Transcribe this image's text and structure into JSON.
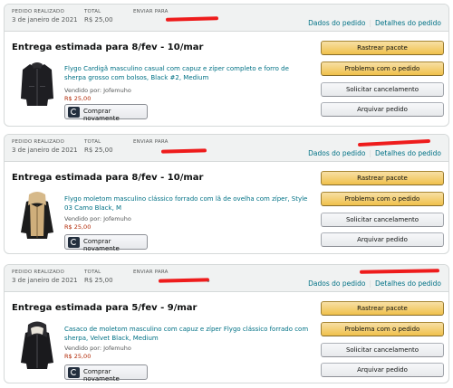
{
  "labels": {
    "order_placed": "PEDIDO REALIZADO",
    "total": "TOTAL",
    "ship_to": "ENVIAR PARA",
    "order_details": "Dados do pedido",
    "invoice_details": "Detalhes do pedido",
    "sold_by": "Vendido por: Jofemuho",
    "buy_again": "Comprar novamente",
    "track": "Rastrear pacote",
    "problem": "Problema com o pedido",
    "cancel": "Solicitar cancelamento",
    "archive": "Arquivar pedido"
  },
  "orders": [
    {
      "date": "3 de janeiro de 2021",
      "total": "R$ 25,00",
      "delivery": "Entrega estimada para 8/fev - 10/mar",
      "product_title": "Flygo Cardigã masculino casual com capuz e zíper completo e forro de sherpa grosso com bolsos, Black #2, Medium",
      "price": "R$ 25,00"
    },
    {
      "date": "3 de janeiro de 2021",
      "total": "R$ 25,00",
      "delivery": "Entrega estimada para 8/fev - 10/mar",
      "product_title": "Flygo moletom masculino clássico forrado com lã de ovelha com zíper, Style 03 Camo Black, M",
      "price": "R$ 25,00"
    },
    {
      "date": "3 de janeiro de 2021",
      "total": "R$ 25,00",
      "delivery": "Entrega estimada para 5/fev - 9/mar",
      "product_title": "Casaco de moletom masculino com capuz e zíper Flygo clássico forrado com sherpa, Velvet Black, Medium",
      "price": "R$ 25,00"
    }
  ],
  "colors": {
    "link": "#007185",
    "price": "#b12704",
    "primary_button": "#f0c14b",
    "redaction": "#ee1c1c"
  }
}
